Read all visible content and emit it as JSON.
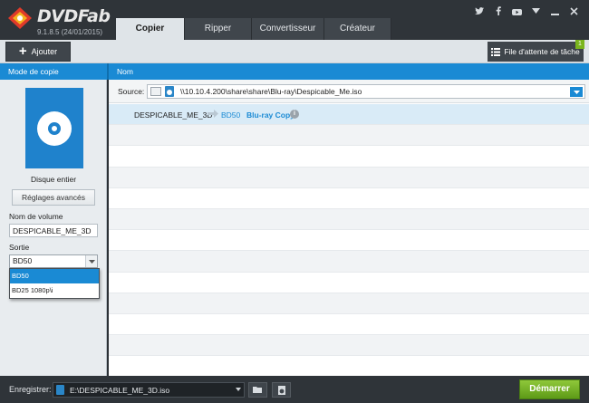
{
  "app": {
    "name": "DVDFab",
    "version": "9.1.8.5 (24/01/2015)"
  },
  "tabs": [
    {
      "label": "Copier",
      "active": true
    },
    {
      "label": "Ripper",
      "active": false
    },
    {
      "label": "Convertisseur",
      "active": false
    },
    {
      "label": "Créateur",
      "active": false
    }
  ],
  "window_controls": [
    "twitter-icon",
    "facebook-icon",
    "youtube-icon",
    "dropdown-icon",
    "minimize-icon",
    "close-icon"
  ],
  "toolbar": {
    "add_label": "Ajouter",
    "queue_label": "File d'attente de tâche",
    "queue_count": "1"
  },
  "headers": {
    "left": "Mode de copie",
    "right": "Nom"
  },
  "left_panel": {
    "mode_label": "Disque entier",
    "advanced_button": "Réglages avancés",
    "volume_label": "Nom de volume",
    "volume_value": "DESPICABLE_ME_3D",
    "output_label": "Sortie",
    "output_value": "BD50",
    "output_options": [
      "BD50",
      "BD25 1080p\\i"
    ]
  },
  "source": {
    "label": "Source:",
    "path": "\\\\10.10.4.200\\share\\share\\Blu-ray\\Despicable_Me.iso"
  },
  "title_row": {
    "name": "DESPICABLE_ME_3D",
    "format": "BD50",
    "mode": "Blu-ray Copy",
    "info": "i"
  },
  "bottom": {
    "save_label": "Enregistrer:",
    "save_path": "E:\\DESPICABLE_ME_3D.iso",
    "start_label": "Démarrer"
  },
  "colors": {
    "accent": "#1a8ad4",
    "start": "#6ea824",
    "dark": "#2f3439"
  }
}
